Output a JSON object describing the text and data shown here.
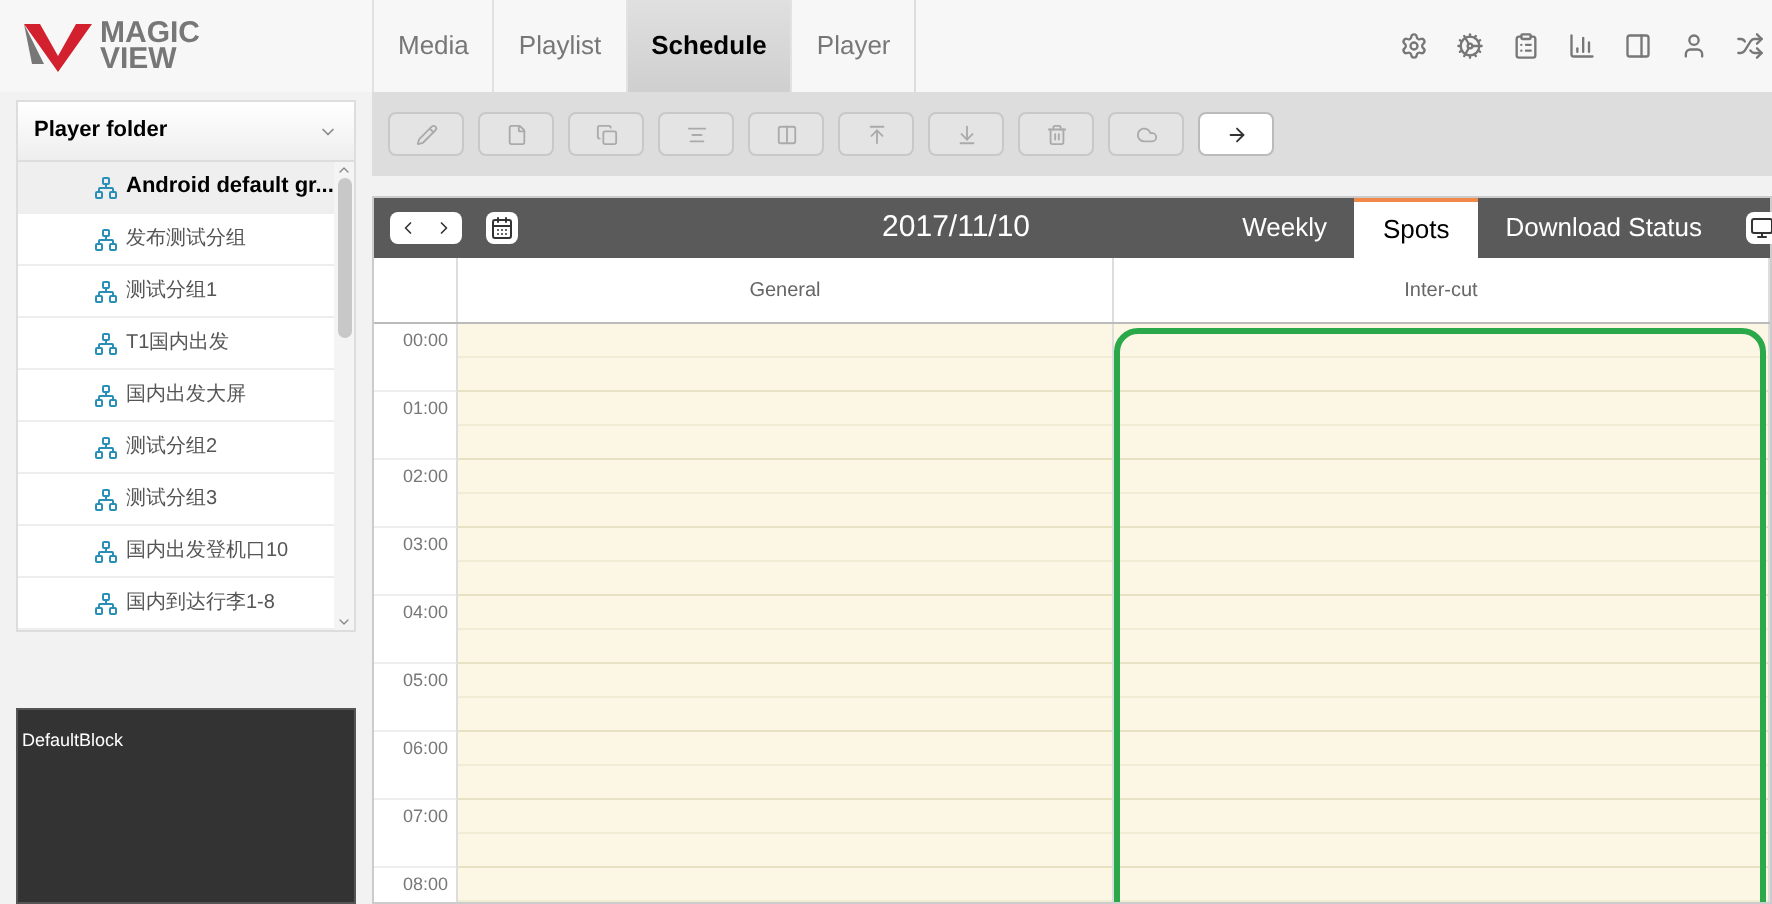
{
  "logo": {
    "line1": "MAGIC",
    "line2": "VIEW"
  },
  "nav_tabs": [
    {
      "label": "Media",
      "selected": false
    },
    {
      "label": "Playlist",
      "selected": false
    },
    {
      "label": "Schedule",
      "selected": true
    },
    {
      "label": "Player",
      "selected": false
    }
  ],
  "toolbar": [
    {
      "kind": "edit",
      "disabled": true
    },
    {
      "kind": "copy",
      "disabled": true
    },
    {
      "kind": "duplicate",
      "disabled": true
    },
    {
      "kind": "align",
      "disabled": true
    },
    {
      "kind": "column",
      "disabled": true
    },
    {
      "kind": "top",
      "disabled": true
    },
    {
      "kind": "bottom",
      "disabled": true
    },
    {
      "kind": "delete",
      "disabled": true
    },
    {
      "kind": "cloud",
      "disabled": true
    },
    {
      "kind": "arrow",
      "disabled": false
    }
  ],
  "sidebar": {
    "title": "Player folder",
    "items": [
      {
        "label": "Android default gr...",
        "selected": true
      },
      {
        "label": "发布测试分组",
        "selected": false
      },
      {
        "label": "测试分组1",
        "selected": false
      },
      {
        "label": "T1国内出发",
        "selected": false
      },
      {
        "label": "国内出发大屏",
        "selected": false
      },
      {
        "label": "测试分组2",
        "selected": false
      },
      {
        "label": "测试分组3",
        "selected": false
      },
      {
        "label": "国内出发登机口10",
        "selected": false
      },
      {
        "label": "国内到达行李1-8",
        "selected": false
      }
    ]
  },
  "preview": {
    "label": "DefaultBlock"
  },
  "schedule": {
    "date": "2017/11/10",
    "views": [
      {
        "label": "Weekly",
        "selected": false
      },
      {
        "label": "Spots",
        "selected": true
      },
      {
        "label": "Download Status",
        "selected": false
      }
    ],
    "columns": [
      "General",
      "Inter-cut"
    ],
    "times": [
      "00:00",
      "01:00",
      "02:00",
      "03:00",
      "04:00",
      "05:00",
      "06:00",
      "07:00",
      "08:00"
    ]
  }
}
